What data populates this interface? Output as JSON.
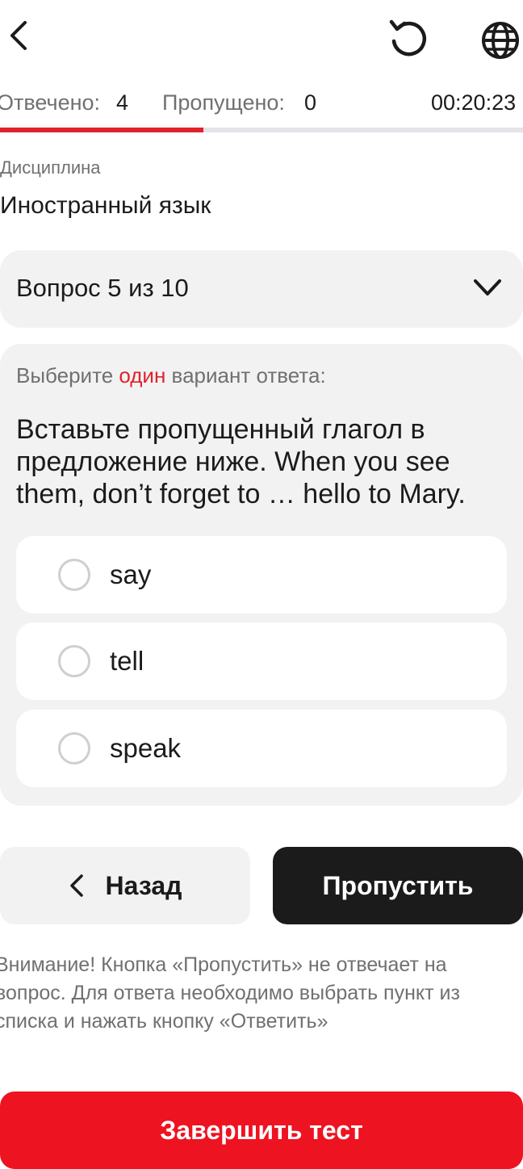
{
  "header": {
    "back_icon": "chevron-left-icon",
    "reset_icon": "rotate-ccw-icon",
    "language_icon": "globe-icon"
  },
  "stats": {
    "answered_label": "Отвечено:",
    "answered_value": "4",
    "skipped_label": "Пропущено:",
    "skipped_value": "0",
    "timer": "00:20:23"
  },
  "progress": {
    "fraction": 0.389,
    "fill_color": "#e0222d",
    "track_color": "#e3e3e8"
  },
  "discipline": {
    "label": "Дисциплина",
    "value": "Иностранный язык"
  },
  "question_selector": {
    "label": "Вопрос 5 из 10"
  },
  "question": {
    "instruction_prefix": "Выберите ",
    "instruction_highlight": "один",
    "instruction_suffix": " вариант ответа:",
    "text": "Вставьте пропущенный глагол в предложение ниже. When you see them, don’t forget to … hello to Mary.",
    "options": [
      "say",
      "tell",
      "speak"
    ]
  },
  "nav": {
    "back_label": "Назад",
    "skip_label": "Пропустить"
  },
  "notice": "Внимание! Кнопка «Пропустить» не отвечает на вопрос. Для ответа необходимо выбрать пункт из списка и нажать кнопку «Ответить»",
  "finish_label": "Завершить тест",
  "colors": {
    "accent": "#e0222d",
    "dark_button": "#1b1b1b",
    "finish_button": "#ee1321"
  }
}
